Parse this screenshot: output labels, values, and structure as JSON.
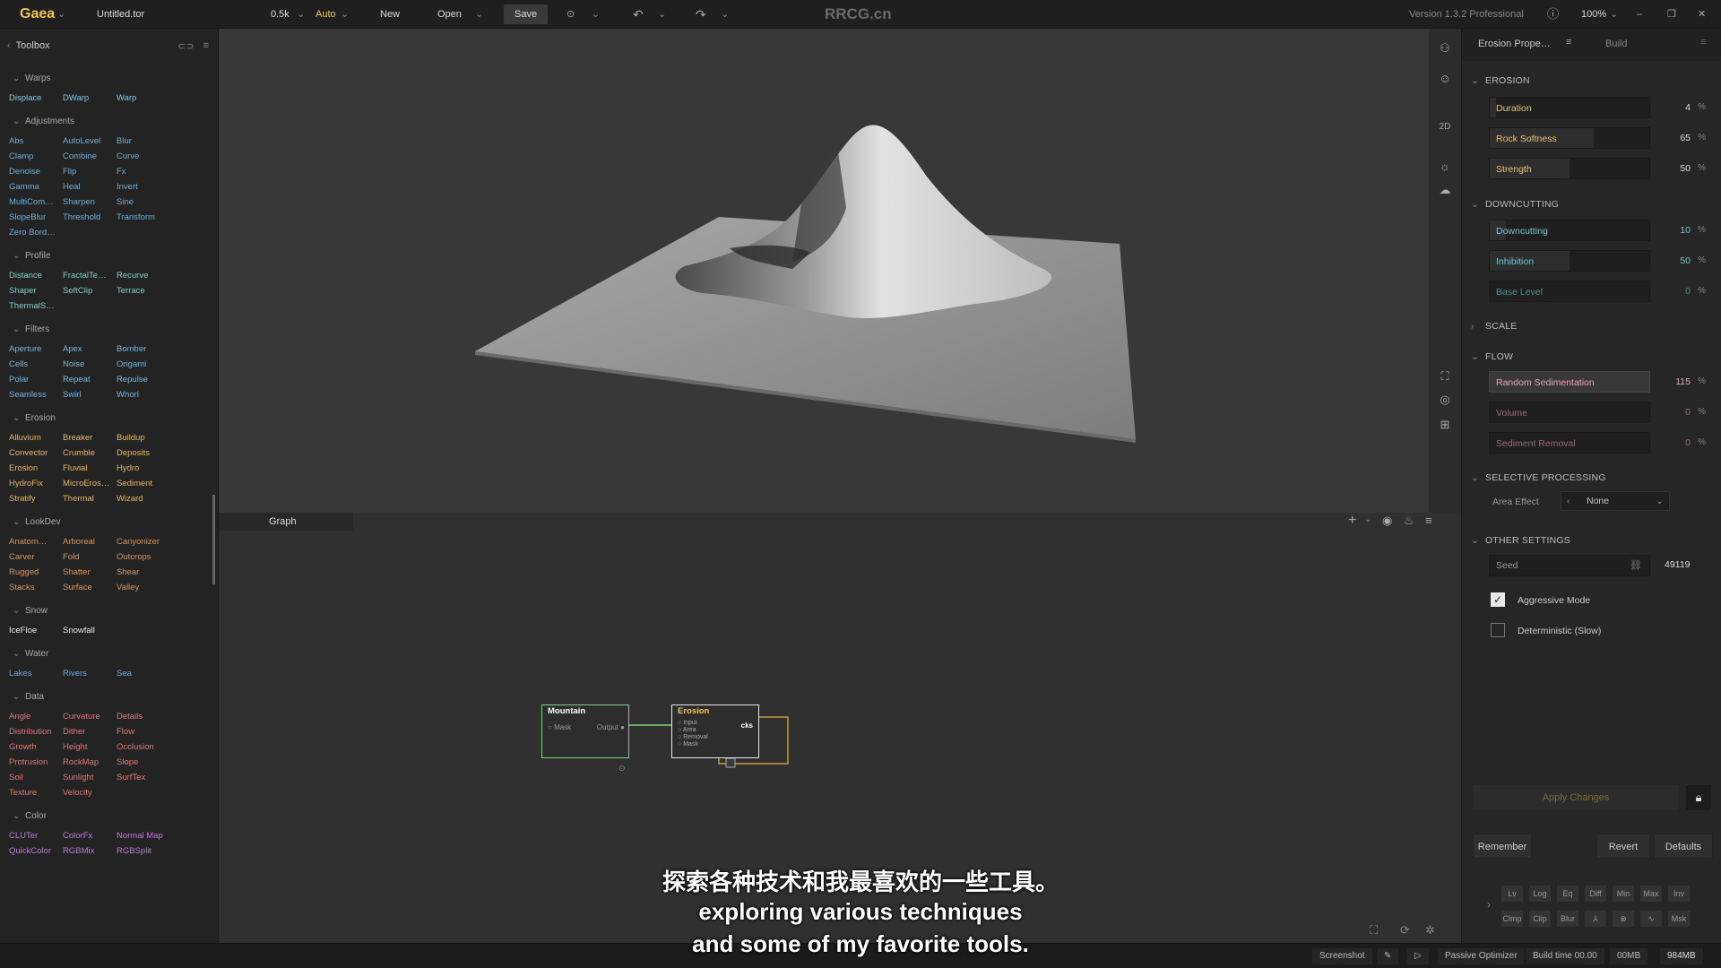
{
  "topbar": {
    "app_name": "Gaea",
    "file_name": "Untitled.tor",
    "resolution": "0.5k",
    "mode": "Auto",
    "new_label": "New",
    "open_label": "Open",
    "save_label": "Save",
    "watermark": "RRCG.cn",
    "version": "Version 1.3.2 Professional",
    "zoom": "100%"
  },
  "toolbox": {
    "title": "Toolbox",
    "categories": [
      {
        "name": "Warps",
        "items": [
          "Displace",
          "DWarp",
          "Warp"
        ],
        "color": "#7fc8e8"
      },
      {
        "name": "Adjustments",
        "items": [
          "Abs",
          "AutoLevel",
          "Blur",
          "Clamp",
          "Combine",
          "Curve",
          "Denoise",
          "Flip",
          "Fx",
          "Gamma",
          "Heal",
          "Invert",
          "MultiCom…",
          "Sharpen",
          "Sine",
          "SlopeBlur",
          "Threshold",
          "Transform",
          "Zero Bord…"
        ],
        "color": "#6fb0d8"
      },
      {
        "name": "Profile",
        "items": [
          "Distance",
          "FractalTe…",
          "Recurve",
          "Shaper",
          "SoftClip",
          "Terrace",
          "ThermalS…"
        ],
        "color": "#7fd0c8"
      },
      {
        "name": "Filters",
        "items": [
          "Aperture",
          "Apex",
          "Bomber",
          "Cells",
          "Noise",
          "Origami",
          "Polar",
          "Repeat",
          "Repulse",
          "Seamless",
          "Swirl",
          "Whorl"
        ],
        "color": "#6fb8e0"
      },
      {
        "name": "Erosion",
        "items": [
          "Alluvium",
          "Breaker",
          "Buildup",
          "Convector",
          "Crumble",
          "Deposits",
          "Erosion",
          "Fluvial",
          "Hydro",
          "HydroFix",
          "MicroEros…",
          "Sediment",
          "Stratify",
          "Thermal",
          "Wizard"
        ],
        "color": "#e6b85a"
      },
      {
        "name": "LookDev",
        "items": [
          "Anatom…",
          "Arboreal",
          "Canyonizer",
          "Carver",
          "Fold",
          "Outcrops",
          "Rugged",
          "Shatter",
          "Shear",
          "Stacks",
          "Surface",
          "Valley"
        ],
        "color": "#d9955a"
      },
      {
        "name": "Snow",
        "items": [
          "IceFloe",
          "Snowfall"
        ],
        "color": "#e8e8e8"
      },
      {
        "name": "Water",
        "items": [
          "Lakes",
          "Rivers",
          "Sea"
        ],
        "color": "#6fa8e8"
      },
      {
        "name": "Data",
        "items": [
          "Angle",
          "Curvature",
          "Details",
          "Distribution",
          "Dither",
          "Flow",
          "Growth",
          "Height",
          "Occlusion",
          "Protrusion",
          "RockMap",
          "Slope",
          "Soil",
          "Sunlight",
          "SurfTex",
          "Texture",
          "Velocity"
        ],
        "color": "#e07878"
      },
      {
        "name": "Color",
        "items": [
          "CLUTer",
          "ColorFx",
          "Normal Map",
          "QuickColor",
          "RGBMix",
          "RGBSplit"
        ],
        "color": "#c078e0"
      }
    ]
  },
  "graph": {
    "tab_label": "Graph",
    "nodes": {
      "mountain": {
        "title": "Mountain",
        "port_in": "Mask",
        "port_out": "Output"
      },
      "erosion": {
        "title": "Erosion",
        "ports": [
          "Input",
          "Area",
          "Removal",
          "Mask"
        ],
        "port_out": "cks"
      }
    }
  },
  "right_panel": {
    "tab_properties": "Erosion Prope…",
    "tab_build": "Build",
    "sections": {
      "erosion": "EROSION",
      "downcutting": "DOWNCUTTING",
      "scale": "SCALE",
      "flow": "FLOW",
      "selective": "SELECTIVE PROCESSING",
      "other": "OTHER SETTINGS"
    },
    "params": {
      "duration": {
        "label": "Duration",
        "value": "4",
        "unit": "%",
        "fraction": 0.04
      },
      "rock_softness": {
        "label": "Rock Softness",
        "value": "65",
        "unit": "%",
        "fraction": 0.65
      },
      "strength": {
        "label": "Strength",
        "value": "50",
        "unit": "%",
        "fraction": 0.5
      },
      "downcutting": {
        "label": "Downcutting",
        "value": "10",
        "unit": "%",
        "fraction": 0.1
      },
      "inhibition": {
        "label": "Inhibition",
        "value": "50",
        "unit": "%",
        "fraction": 0.5
      },
      "base_level": {
        "label": "Base Level",
        "value": "0",
        "unit": "%",
        "fraction": 0.0
      },
      "random_sedimentation": {
        "label": "Random Sedimentation",
        "value": "115",
        "unit": "%",
        "fraction": 1.0
      },
      "volume": {
        "label": "Volume",
        "value": "0",
        "unit": "%",
        "fraction": 0.0
      },
      "sediment_removal": {
        "label": "Sediment Removal",
        "value": "0",
        "unit": "%",
        "fraction": 0.0
      }
    },
    "area_effect_label": "Area Effect",
    "area_effect_value": "None",
    "seed_label": "Seed",
    "seed_value": "49119",
    "aggressive_mode": "Aggressive Mode",
    "deterministic": "Deterministic (Slow)",
    "apply_changes": "Apply Changes",
    "remember": "Remember",
    "revert": "Revert",
    "defaults": "Defaults",
    "mini_row1": [
      "Lv",
      "Log",
      "Eq",
      "Diff",
      "Min",
      "Max",
      "Inv"
    ],
    "mini_row2": [
      "Clmp",
      "Clip",
      "Blur",
      "⅄",
      "⊗",
      "∿",
      "Msk"
    ]
  },
  "status": {
    "screenshot": "Screenshot",
    "passive_optimizer": "Passive Optimizer",
    "build_time": "Build time 00.00",
    "mem1": "00MB",
    "mem2": "984MB"
  },
  "subtitles": {
    "chinese": "探索各种技术和我最喜欢的一些工具。",
    "line1": "exploring various techniques",
    "line2": "and some of my favorite tools."
  },
  "colors": {
    "accent": "#f3c34a",
    "param_label": "#e8c46a",
    "node_green": "#7fd07f"
  }
}
